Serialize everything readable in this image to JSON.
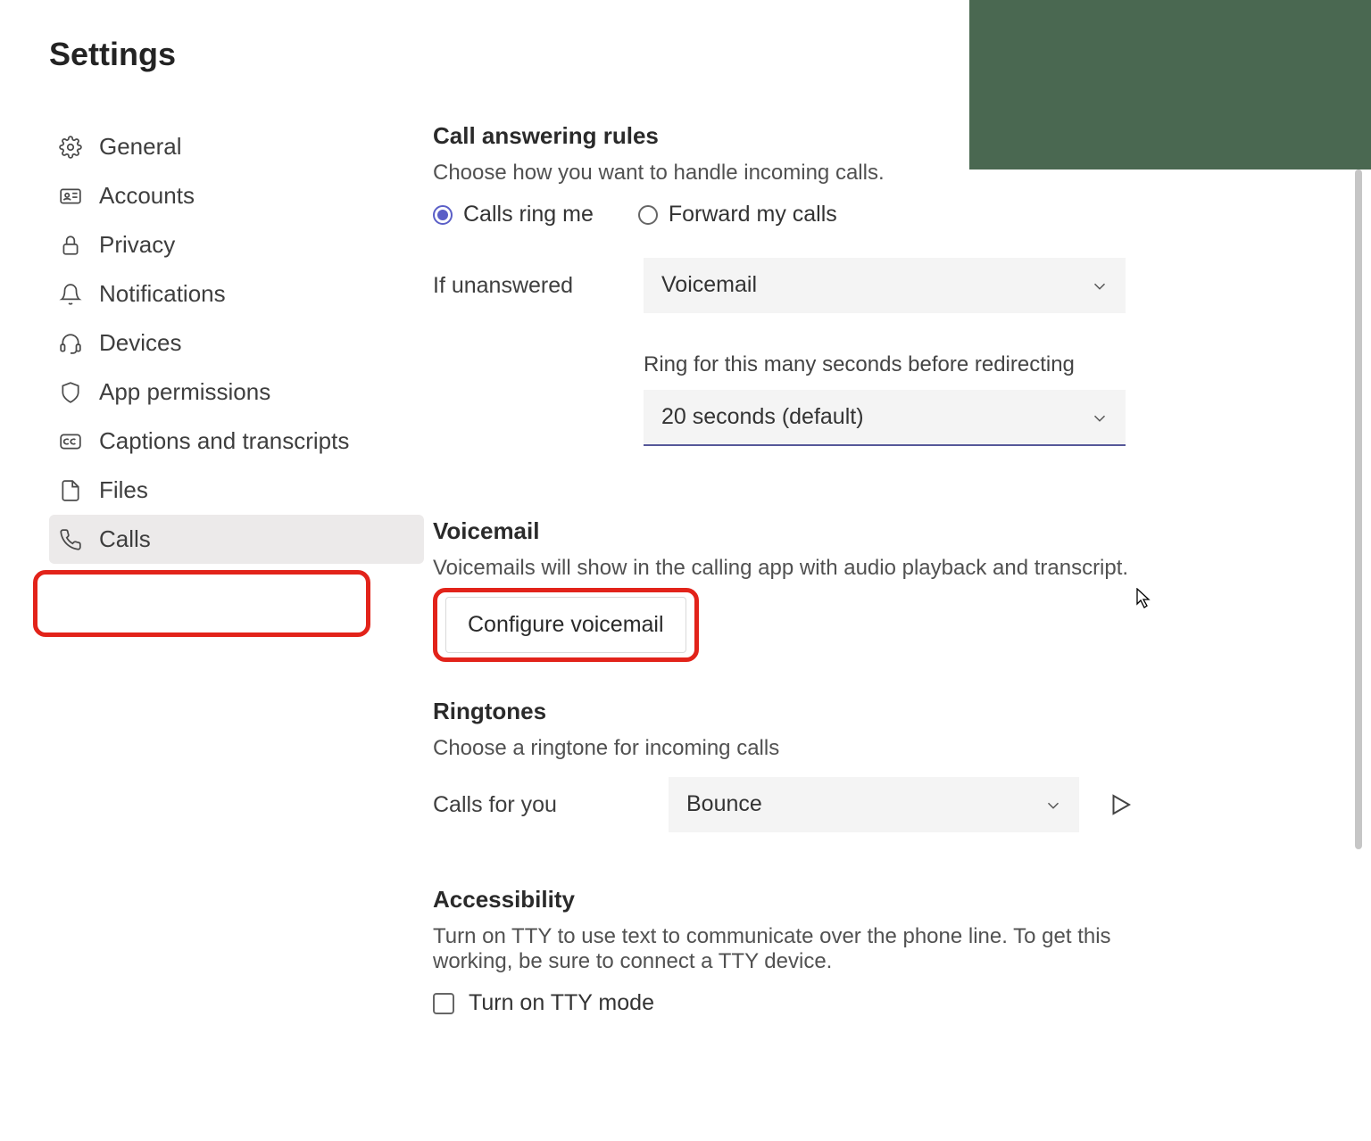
{
  "page_title": "Settings",
  "sidebar": {
    "items": [
      {
        "label": "General",
        "icon": "gear-icon",
        "active": false
      },
      {
        "label": "Accounts",
        "icon": "id-card-icon",
        "active": false
      },
      {
        "label": "Privacy",
        "icon": "lock-icon",
        "active": false
      },
      {
        "label": "Notifications",
        "icon": "bell-icon",
        "active": false
      },
      {
        "label": "Devices",
        "icon": "headset-icon",
        "active": false
      },
      {
        "label": "App permissions",
        "icon": "shield-icon",
        "active": false
      },
      {
        "label": "Captions and transcripts",
        "icon": "cc-icon",
        "active": false
      },
      {
        "label": "Files",
        "icon": "file-icon",
        "active": false
      },
      {
        "label": "Calls",
        "icon": "phone-icon",
        "active": true
      }
    ]
  },
  "call_answering": {
    "title": "Call answering rules",
    "description": "Choose how you want to handle incoming calls.",
    "radio_ring_me": "Calls ring me",
    "radio_forward": "Forward my calls",
    "radio_selected": "ring_me",
    "if_unanswered_label": "If unanswered",
    "if_unanswered_value": "Voicemail",
    "ring_help": "Ring for this many seconds before redirecting",
    "ring_value": "20 seconds (default)"
  },
  "voicemail": {
    "title": "Voicemail",
    "description": "Voicemails will show in the calling app with audio playback and transcript.",
    "configure_btn": "Configure voicemail"
  },
  "ringtones": {
    "title": "Ringtones",
    "description": "Choose a ringtone for incoming calls",
    "calls_for_you_label": "Calls for you",
    "calls_for_you_value": "Bounce"
  },
  "accessibility": {
    "title": "Accessibility",
    "description": "Turn on TTY to use text to communicate over the phone line. To get this working, be sure to connect a TTY device.",
    "tty_label": "Turn on TTY mode",
    "tty_checked": false
  }
}
